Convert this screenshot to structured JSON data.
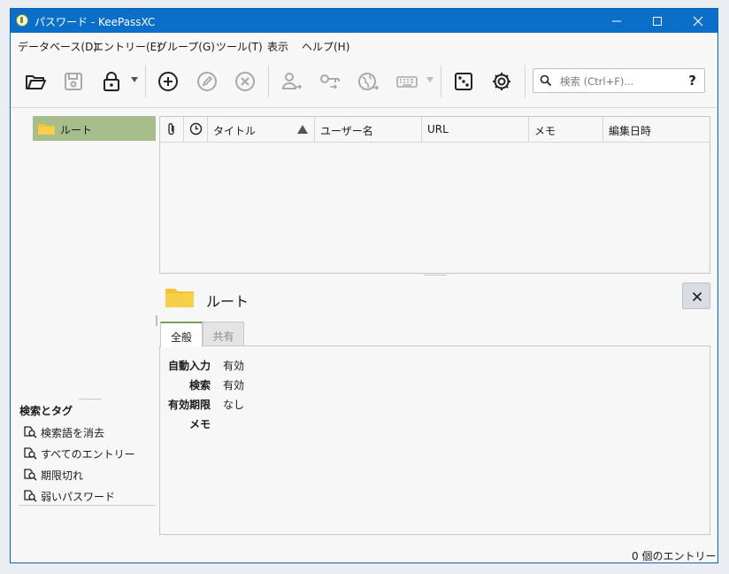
{
  "window": {
    "title": "パスワード - KeePassXC"
  },
  "menu": [
    "データベース(D)",
    "エントリー(E)",
    "グループ(G)",
    "ツール(T)",
    "表示",
    "ヘルプ(H)"
  ],
  "toolbar": {
    "icons": [
      "open-folder",
      "save",
      "lock",
      "add-entry",
      "edit-entry",
      "delete-entry",
      "copy-username",
      "copy-password",
      "open-url",
      "autotype-keyboard",
      "password-generator-dice",
      "settings-gear"
    ]
  },
  "search": {
    "placeholder": "検索 (Ctrl+F)...",
    "help": "?"
  },
  "tree": {
    "root_label": "ルート"
  },
  "table": {
    "columns": [
      "タイトル",
      "ユーザー名",
      "URL",
      "メモ",
      "編集日時"
    ]
  },
  "preview": {
    "group_name": "ルート",
    "tabs": [
      "全般",
      "共有"
    ],
    "props": [
      {
        "key": "自動入力",
        "value": "有効"
      },
      {
        "key": "検索",
        "value": "有効"
      },
      {
        "key": "有効期限",
        "value": "なし"
      },
      {
        "key": "メモ",
        "value": ""
      }
    ]
  },
  "tags": {
    "heading": "検索とタグ",
    "items": [
      "検索語を消去",
      "すべてのエントリー",
      "期限切れ",
      "弱いパスワード"
    ]
  },
  "status": {
    "entry_count": "0 個のエントリー"
  },
  "colors": {
    "titlebar": "#0b6fc9",
    "selection": "#a7be8c",
    "tab_accent": "#7b9f52",
    "folder": "#f4c430"
  }
}
